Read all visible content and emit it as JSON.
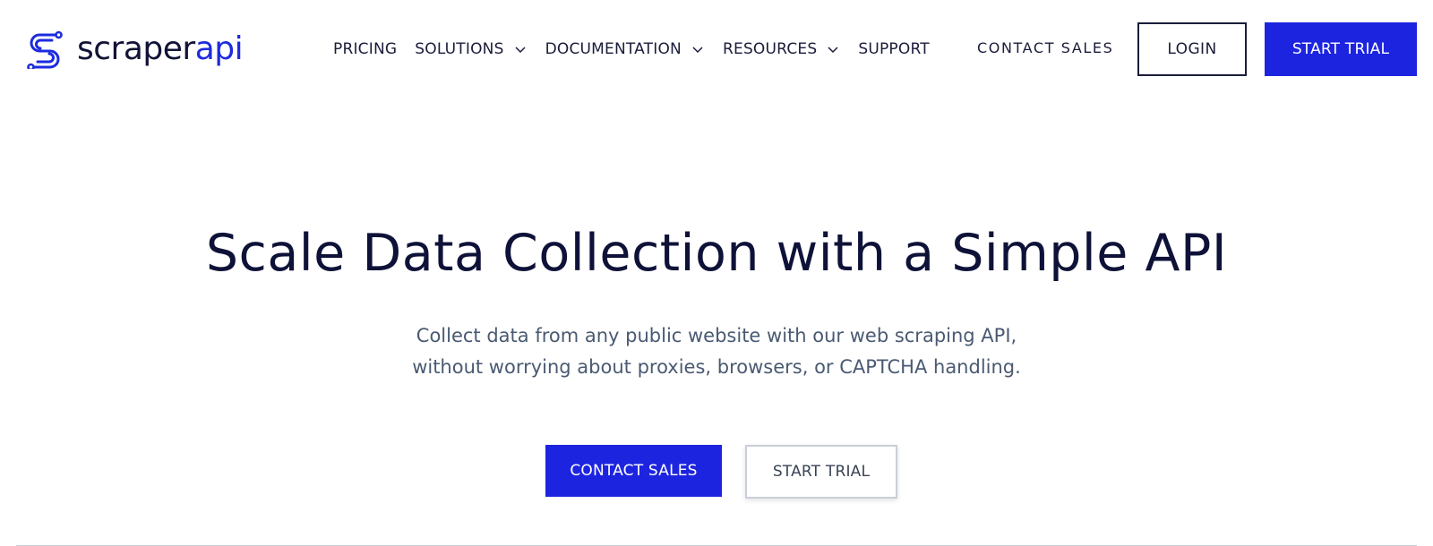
{
  "brand": {
    "name_main": "scraper",
    "name_accent": "api",
    "logo_icon": "scraperapi-s-logo-icon",
    "accent_color": "#1d24e0",
    "text_color": "#111336"
  },
  "nav": {
    "items": [
      {
        "label": "PRICING",
        "has_dropdown": false
      },
      {
        "label": "SOLUTIONS",
        "has_dropdown": true
      },
      {
        "label": "DOCUMENTATION",
        "has_dropdown": true
      },
      {
        "label": "RESOURCES",
        "has_dropdown": true
      },
      {
        "label": "SUPPORT",
        "has_dropdown": false
      }
    ],
    "dropdown_icon": "chevron-down-icon"
  },
  "header_actions": {
    "contact_sales": "CONTACT SALES",
    "login": "LOGIN",
    "start_trial": "START TRIAL"
  },
  "hero": {
    "title": "Scale Data Collection with a Simple API",
    "subtitle_line1": "Collect data from any public website with our web scraping API,",
    "subtitle_line2": "without worrying about proxies, browsers, or CAPTCHA handling.",
    "primary_cta": "CONTACT SALES",
    "secondary_cta": "START TRIAL"
  },
  "colors": {
    "primary_button": "#1d24e0",
    "subtitle_text": "#4a5a72",
    "heading_text": "#0f1238",
    "divider": "#c8ccd4"
  }
}
